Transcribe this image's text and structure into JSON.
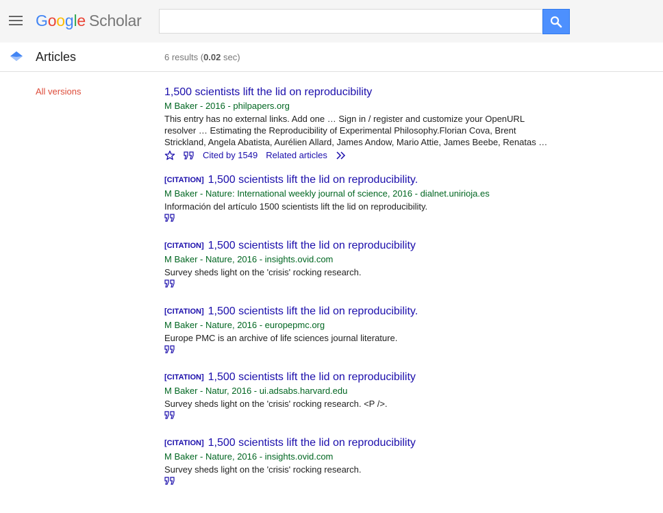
{
  "header": {
    "logo_google": [
      "G",
      "o",
      "o",
      "g",
      "l",
      "e"
    ],
    "logo_scholar": "Scholar",
    "search_value": "",
    "colors": {
      "blue": "#4285f4",
      "red": "#ea4335",
      "yellow": "#fbbc05",
      "green": "#34a853",
      "button": "#4d90fe"
    },
    "icons": {
      "menu": "hamburger-icon",
      "search": "search-icon"
    }
  },
  "subbar": {
    "section": "Articles",
    "results_prefix": "6 results (",
    "results_time": "0.02",
    "results_suffix": " sec)"
  },
  "sidebar": {
    "all_versions": "All versions"
  },
  "results": [
    {
      "citation_tag": "",
      "title": "1,500 scientists lift the lid on reproducibility",
      "meta": "M Baker - 2016 - philpapers.org",
      "snippet": [
        "This entry has no external links. Add one … Sign in / register and customize your OpenURL",
        "resolver … Estimating the Reproducibility of Experimental Philosophy.Florian Cova, Brent",
        "Strickland, Angela Abatista, Aurélien Allard, James Andow, Mario Attie, James Beebe, Renatas …"
      ],
      "cited_by": "Cited by 1549",
      "related": "Related articles"
    },
    {
      "citation_tag": "[CITATION]",
      "title": "1,500 scientists lift the lid on reproducibility.",
      "meta": "M Baker - Nature: International weekly journal of science, 2016 - dialnet.unirioja.es",
      "snippet": [
        "Información del artículo 1500 scientists lift the lid on reproducibility."
      ]
    },
    {
      "citation_tag": "[CITATION]",
      "title": "1,500 scientists lift the lid on reproducibility",
      "meta": "M Baker - Nature, 2016 - insights.ovid.com",
      "snippet": [
        "Survey sheds light on the 'crisis' rocking research."
      ]
    },
    {
      "citation_tag": "[CITATION]",
      "title": "1,500 scientists lift the lid on reproducibility.",
      "meta": "M Baker - Nature, 2016 - europepmc.org",
      "snippet": [
        "Europe PMC is an archive of life sciences journal literature."
      ]
    },
    {
      "citation_tag": "[CITATION]",
      "title": "1,500 scientists lift the lid on reproducibility",
      "meta": "M Baker - Natur, 2016 - ui.adsabs.harvard.edu",
      "snippet": [
        "Survey sheds light on the 'crisis' rocking research. <P />."
      ]
    },
    {
      "citation_tag": "[CITATION]",
      "title": "1,500 scientists lift the lid on reproducibility",
      "meta": "M Baker - Nature, 2016 - insights.ovid.com",
      "snippet": [
        "Survey sheds light on the 'crisis' rocking research."
      ]
    }
  ]
}
